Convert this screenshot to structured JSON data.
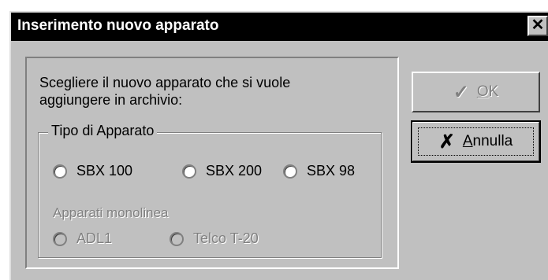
{
  "dialog": {
    "title": "Inserimento nuovo apparato",
    "close_symbol": "✕"
  },
  "prompt": {
    "line1": "Scegliere il nuovo apparato che si  vuole",
    "line2": "aggiungere in archivio:"
  },
  "group": {
    "legend": "Tipo di Apparato",
    "options": [
      "SBX 100",
      "SBX 200",
      "SBX 98"
    ],
    "sub_heading": "Apparati monolinea",
    "sub_options": [
      "ADL1",
      "Telco T-20"
    ]
  },
  "buttons": {
    "ok_label_ul": "O",
    "ok_label_rest": "K",
    "ok_icon": "✓",
    "cancel_label_ul": "A",
    "cancel_label_rest": "nnulla",
    "cancel_icon": "✗"
  }
}
